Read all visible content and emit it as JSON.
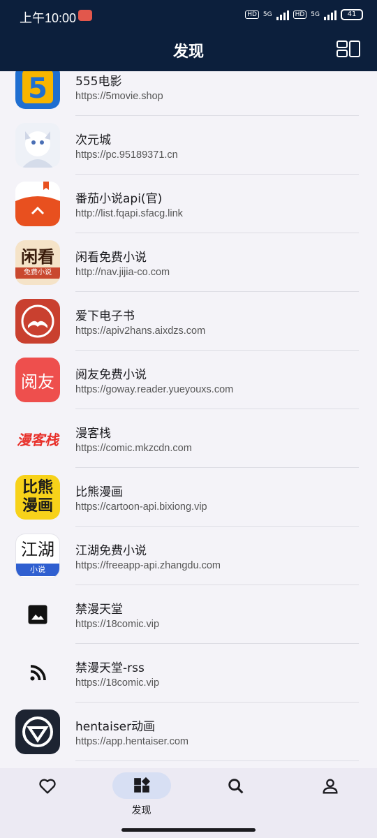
{
  "status": {
    "time": "上午10:00",
    "battery": "41",
    "net": "5G"
  },
  "header": {
    "title": "发现"
  },
  "items": [
    {
      "name": "555电影",
      "url": "https://5movie.shop"
    },
    {
      "name": "次元城",
      "url": "https://pc.95189371.cn"
    },
    {
      "name": "番茄小说api(官)",
      "url": "http://list.fqapi.sfacg.link"
    },
    {
      "name": "闲看免费小说",
      "url": "http://nav.jijia-co.com",
      "logo_text": "闲看",
      "logo_sub": "免费小说"
    },
    {
      "name": "爱下电子书",
      "url": "https://apiv2hans.aixdzs.com"
    },
    {
      "name": "阅友免费小说",
      "url": "https://goway.reader.yueyouxs.com",
      "logo_text": "阅友"
    },
    {
      "name": "漫客栈",
      "url": "https://comic.mkzcdn.com",
      "logo_text": "漫客栈"
    },
    {
      "name": "比熊漫画",
      "url": "https://cartoon-api.bixiong.vip",
      "logo_text": "比熊漫画"
    },
    {
      "name": "江湖免费小说",
      "url": "https://freeapp-api.zhangdu.com",
      "logo_text": "江湖",
      "logo_sub": "小说"
    },
    {
      "name": "禁漫天堂",
      "url": "https://18comic.vip"
    },
    {
      "name": "禁漫天堂-rss",
      "url": "https://18comic.vip"
    },
    {
      "name": "hentaiser动画",
      "url": "https://app.hentaiser.com"
    }
  ],
  "nav": {
    "active_label": "发现"
  },
  "colors": {
    "header_bg": "#0c1f3c",
    "page_bg": "#f4f3f8",
    "nav_bg": "#eceaf3",
    "active_pill": "#d7dff3"
  }
}
